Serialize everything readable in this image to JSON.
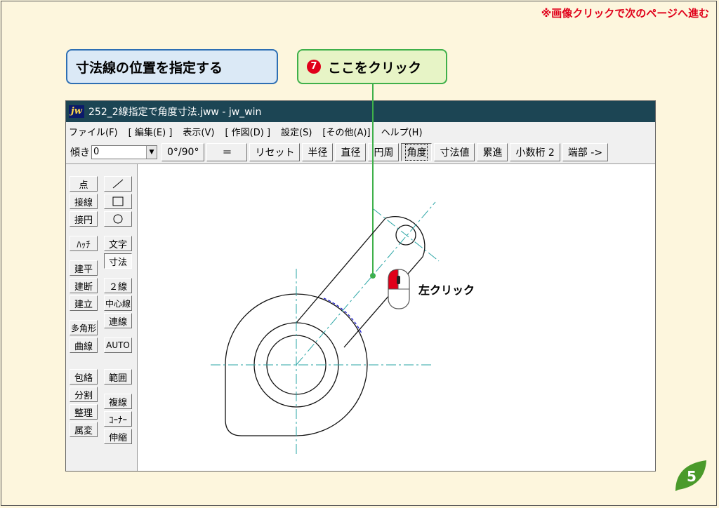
{
  "header_note": "※画像クリックで次のページへ進む",
  "callouts": {
    "step_title": "寸法線の位置を指定する",
    "click_number": "7",
    "click_text": "ここをクリック"
  },
  "window": {
    "title": "252_2線指定で角度寸法.jww - jw_win",
    "logo": "jw",
    "menu": [
      "ファイル(F)",
      "[ 編集(E) ]",
      "表示(V)",
      "[ 作図(D) ]",
      "設定(S)",
      "[その他(A)]",
      "ヘルプ(H)"
    ]
  },
  "toolbar": {
    "angle_label": "傾き",
    "angle_value": "0",
    "buttons": [
      {
        "label": "0°/90°",
        "pressed": false
      },
      {
        "label": "＝",
        "pressed": false
      },
      {
        "label": "リセット",
        "pressed": false
      },
      {
        "label": "半径",
        "pressed": false
      },
      {
        "label": "直径",
        "pressed": false
      },
      {
        "label": "円周",
        "pressed": false
      },
      {
        "label": "角度",
        "pressed": true
      },
      {
        "label": "寸法値",
        "pressed": false
      },
      {
        "label": "累進",
        "pressed": false
      },
      {
        "label": "小数桁 2",
        "pressed": false
      },
      {
        "label": "端部 ->",
        "pressed": false
      }
    ]
  },
  "left_tools_col1": [
    "点",
    "接線",
    "接円",
    "ﾊｯﾁ",
    "建平",
    "建断",
    "建立",
    "多角形",
    "曲線",
    "包絡",
    "分割",
    "整理",
    "属変"
  ],
  "left_tools_col2": {
    "line_icon": "line-icon",
    "rect_icon": "rectangle-icon",
    "circle_icon": "circle-icon",
    "labels": [
      "文字",
      "寸法",
      "２線",
      "中心線",
      "連線",
      "AUTO",
      "範囲",
      "複線",
      "ｺｰﾅｰ",
      "伸縮"
    ],
    "active": "寸法"
  },
  "mouse_hint": "左クリック",
  "page_number": "5",
  "colors": {
    "note_red": "#e0001a",
    "callout_blue_border": "#2e6fb3",
    "callout_green_border": "#3fb04a",
    "titlebar": "#1c4554",
    "center_line": "#2aa5a5",
    "angle_arc": "#2222cc",
    "page_badge": "#4a9a2a"
  }
}
